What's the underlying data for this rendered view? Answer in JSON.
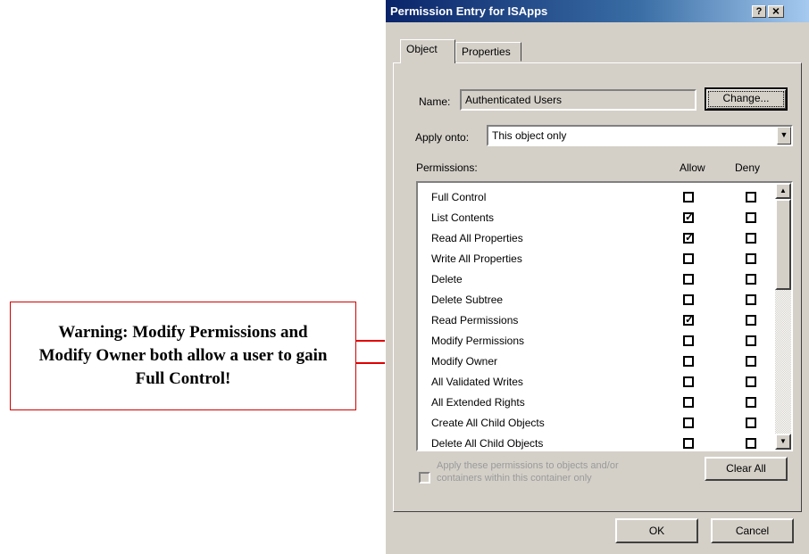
{
  "callout": {
    "text": "Warning: Modify Permissions and Modify Owner both allow a user to gain Full Control!"
  },
  "window": {
    "title": "Permission Entry for ISApps",
    "help_glyph": "?",
    "close_glyph": "×"
  },
  "tabs": [
    {
      "label": "Object"
    },
    {
      "label": "Properties"
    }
  ],
  "name": {
    "label": "Name:",
    "value": "Authenticated Users",
    "change_button": "Change..."
  },
  "apply_onto": {
    "label": "Apply onto:",
    "value": "This object only"
  },
  "permissions": {
    "label": "Permissions:",
    "col_allow": "Allow",
    "col_deny": "Deny",
    "rows": [
      {
        "name": "Full Control",
        "allow": false,
        "deny": false
      },
      {
        "name": "List Contents",
        "allow": true,
        "deny": false
      },
      {
        "name": "Read All Properties",
        "allow": true,
        "deny": false
      },
      {
        "name": "Write All Properties",
        "allow": false,
        "deny": false
      },
      {
        "name": "Delete",
        "allow": false,
        "deny": false
      },
      {
        "name": "Delete Subtree",
        "allow": false,
        "deny": false
      },
      {
        "name": "Read Permissions",
        "allow": true,
        "deny": false
      },
      {
        "name": "Modify Permissions",
        "allow": false,
        "deny": false
      },
      {
        "name": "Modify Owner",
        "allow": false,
        "deny": false
      },
      {
        "name": "All Validated Writes",
        "allow": false,
        "deny": false
      },
      {
        "name": "All Extended Rights",
        "allow": false,
        "deny": false
      },
      {
        "name": "Create All Child Objects",
        "allow": false,
        "deny": false
      },
      {
        "name": "Delete All Child Objects",
        "allow": false,
        "deny": false
      }
    ]
  },
  "apply_container": {
    "text": "Apply these permissions to objects and/or containers within this container only"
  },
  "buttons": {
    "clear_all": "Clear All",
    "ok": "OK",
    "cancel": "Cancel"
  },
  "colors": {
    "title_start": "#0a246a",
    "title_end": "#a6caf0",
    "face": "#d4d0c8",
    "callout_border": "#d00000",
    "arrow": "#e00000"
  }
}
